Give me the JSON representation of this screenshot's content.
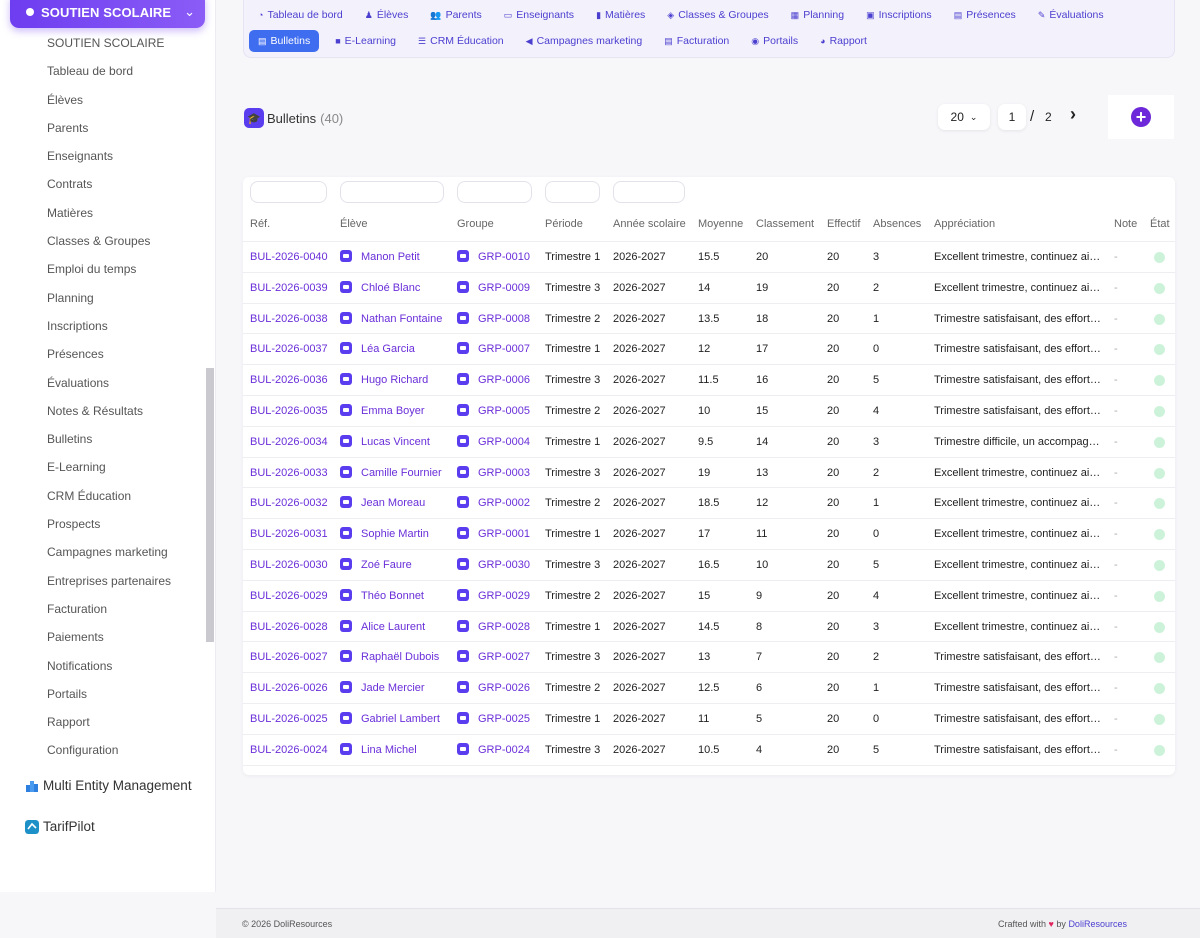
{
  "sidebar": {
    "module_title": "SOUTIEN SCOLAIRE",
    "items": [
      "SOUTIEN SCOLAIRE",
      "Tableau de bord",
      "Élèves",
      "Parents",
      "Enseignants",
      "Contrats",
      "Matières",
      "Classes & Groupes",
      "Emploi du temps",
      "Planning",
      "Inscriptions",
      "Présences",
      "Évaluations",
      "Notes & Résultats",
      "Bulletins",
      "E-Learning",
      "CRM Éducation",
      "Prospects",
      "Campagnes marketing",
      "Entreprises partenaires",
      "Facturation",
      "Paiements",
      "Notifications",
      "Portails",
      "Rapport",
      "Configuration"
    ],
    "ext_modules": [
      "Multi Entity Management",
      "TarifPilot"
    ]
  },
  "topnav": {
    "row1": [
      {
        "label": "Tableau de bord",
        "icon": "dashboard-icon"
      },
      {
        "label": "Élèves",
        "icon": "student-icon"
      },
      {
        "label": "Parents",
        "icon": "users-icon"
      },
      {
        "label": "Enseignants",
        "icon": "teacher-icon"
      },
      {
        "label": "Matières",
        "icon": "book-icon"
      },
      {
        "label": "Classes & Groupes",
        "icon": "layers-icon"
      },
      {
        "label": "Planning",
        "icon": "calendar-icon"
      },
      {
        "label": "Inscriptions",
        "icon": "clipboard-check-icon"
      },
      {
        "label": "Présences",
        "icon": "list-icon"
      },
      {
        "label": "Évaluations",
        "icon": "pen-icon"
      }
    ],
    "row2": [
      {
        "label": "Bulletins",
        "icon": "document-icon",
        "active": true
      },
      {
        "label": "E-Learning",
        "icon": "video-icon"
      },
      {
        "label": "CRM Éducation",
        "icon": "list-lines-icon"
      },
      {
        "label": "Campagnes marketing",
        "icon": "megaphone-icon"
      },
      {
        "label": "Facturation",
        "icon": "invoice-icon"
      },
      {
        "label": "Portails",
        "icon": "user-circle-icon"
      },
      {
        "label": "Rapport",
        "icon": "chart-pie-icon"
      }
    ]
  },
  "list": {
    "title": "Bulletins",
    "count": "(40)",
    "per_page": "20",
    "page_current": "1",
    "page_sep": "/",
    "page_total": "2",
    "next_symbol": "›",
    "add_symbol": "+"
  },
  "columns": [
    "Réf.",
    "Élève",
    "Groupe",
    "Période",
    "Année scolaire",
    "Moyenne",
    "Classement",
    "Effectif",
    "Absences",
    "Appréciation",
    "Note",
    "État"
  ],
  "rows": [
    {
      "ref": "BUL-2026-0040",
      "eleve": "Manon Petit",
      "groupe": "GRP-0010",
      "periode": "Trimestre 1",
      "annee": "2026-2027",
      "moyenne": "15.5",
      "classement": "20",
      "effectif": "20",
      "absences": "3",
      "appreciation": "Excellent trimestre, continuez ainsi.",
      "note": "-"
    },
    {
      "ref": "BUL-2026-0039",
      "eleve": "Chloé Blanc",
      "groupe": "GRP-0009",
      "periode": "Trimestre 3",
      "annee": "2026-2027",
      "moyenne": "14",
      "classement": "19",
      "effectif": "20",
      "absences": "2",
      "appreciation": "Excellent trimestre, continuez ainsi.",
      "note": "-"
    },
    {
      "ref": "BUL-2026-0038",
      "eleve": "Nathan Fontaine",
      "groupe": "GRP-0008",
      "periode": "Trimestre 2",
      "annee": "2026-2027",
      "moyenne": "13.5",
      "classement": "18",
      "effectif": "20",
      "absences": "1",
      "appreciation": "Trimestre satisfaisant, des efforts à poursuivre.",
      "note": "-"
    },
    {
      "ref": "BUL-2026-0037",
      "eleve": "Léa Garcia",
      "groupe": "GRP-0007",
      "periode": "Trimestre 1",
      "annee": "2026-2027",
      "moyenne": "12",
      "classement": "17",
      "effectif": "20",
      "absences": "0",
      "appreciation": "Trimestre satisfaisant, des efforts à poursuivre.",
      "note": "-"
    },
    {
      "ref": "BUL-2026-0036",
      "eleve": "Hugo Richard",
      "groupe": "GRP-0006",
      "periode": "Trimestre 3",
      "annee": "2026-2027",
      "moyenne": "11.5",
      "classement": "16",
      "effectif": "20",
      "absences": "5",
      "appreciation": "Trimestre satisfaisant, des efforts à poursuivre.",
      "note": "-"
    },
    {
      "ref": "BUL-2026-0035",
      "eleve": "Emma Boyer",
      "groupe": "GRP-0005",
      "periode": "Trimestre 2",
      "annee": "2026-2027",
      "moyenne": "10",
      "classement": "15",
      "effectif": "20",
      "absences": "4",
      "appreciation": "Trimestre satisfaisant, des efforts à poursuivre.",
      "note": "-"
    },
    {
      "ref": "BUL-2026-0034",
      "eleve": "Lucas Vincent",
      "groupe": "GRP-0004",
      "periode": "Trimestre 1",
      "annee": "2026-2027",
      "moyenne": "9.5",
      "classement": "14",
      "effectif": "20",
      "absences": "3",
      "appreciation": "Trimestre difficile, un accompagnement est conseillé.",
      "note": "-"
    },
    {
      "ref": "BUL-2026-0033",
      "eleve": "Camille Fournier",
      "groupe": "GRP-0003",
      "periode": "Trimestre 3",
      "annee": "2026-2027",
      "moyenne": "19",
      "classement": "13",
      "effectif": "20",
      "absences": "2",
      "appreciation": "Excellent trimestre, continuez ainsi.",
      "note": "-"
    },
    {
      "ref": "BUL-2026-0032",
      "eleve": "Jean Moreau",
      "groupe": "GRP-0002",
      "periode": "Trimestre 2",
      "annee": "2026-2027",
      "moyenne": "18.5",
      "classement": "12",
      "effectif": "20",
      "absences": "1",
      "appreciation": "Excellent trimestre, continuez ainsi.",
      "note": "-"
    },
    {
      "ref": "BUL-2026-0031",
      "eleve": "Sophie Martin",
      "groupe": "GRP-0001",
      "periode": "Trimestre 1",
      "annee": "2026-2027",
      "moyenne": "17",
      "classement": "11",
      "effectif": "20",
      "absences": "0",
      "appreciation": "Excellent trimestre, continuez ainsi.",
      "note": "-"
    },
    {
      "ref": "BUL-2026-0030",
      "eleve": "Zoé Faure",
      "groupe": "GRP-0030",
      "periode": "Trimestre 3",
      "annee": "2026-2027",
      "moyenne": "16.5",
      "classement": "10",
      "effectif": "20",
      "absences": "5",
      "appreciation": "Excellent trimestre, continuez ainsi.",
      "note": "-"
    },
    {
      "ref": "BUL-2026-0029",
      "eleve": "Théo Bonnet",
      "groupe": "GRP-0029",
      "periode": "Trimestre 2",
      "annee": "2026-2027",
      "moyenne": "15",
      "classement": "9",
      "effectif": "20",
      "absences": "4",
      "appreciation": "Excellent trimestre, continuez ainsi.",
      "note": "-"
    },
    {
      "ref": "BUL-2026-0028",
      "eleve": "Alice Laurent",
      "groupe": "GRP-0028",
      "periode": "Trimestre 1",
      "annee": "2026-2027",
      "moyenne": "14.5",
      "classement": "8",
      "effectif": "20",
      "absences": "3",
      "appreciation": "Excellent trimestre, continuez ainsi.",
      "note": "-"
    },
    {
      "ref": "BUL-2026-0027",
      "eleve": "Raphaël Dubois",
      "groupe": "GRP-0027",
      "periode": "Trimestre 3",
      "annee": "2026-2027",
      "moyenne": "13",
      "classement": "7",
      "effectif": "20",
      "absences": "2",
      "appreciation": "Trimestre satisfaisant, des efforts à poursuivre.",
      "note": "-"
    },
    {
      "ref": "BUL-2026-0026",
      "eleve": "Jade Mercier",
      "groupe": "GRP-0026",
      "periode": "Trimestre 2",
      "annee": "2026-2027",
      "moyenne": "12.5",
      "classement": "6",
      "effectif": "20",
      "absences": "1",
      "appreciation": "Trimestre satisfaisant, des efforts à poursuivre.",
      "note": "-"
    },
    {
      "ref": "BUL-2026-0025",
      "eleve": "Gabriel Lambert",
      "groupe": "GRP-0025",
      "periode": "Trimestre 1",
      "annee": "2026-2027",
      "moyenne": "11",
      "classement": "5",
      "effectif": "20",
      "absences": "0",
      "appreciation": "Trimestre satisfaisant, des efforts à poursuivre.",
      "note": "-"
    },
    {
      "ref": "BUL-2026-0024",
      "eleve": "Lina Michel",
      "groupe": "GRP-0024",
      "periode": "Trimestre 3",
      "annee": "2026-2027",
      "moyenne": "10.5",
      "classement": "4",
      "effectif": "20",
      "absences": "5",
      "appreciation": "Trimestre satisfaisant, des efforts à poursuivre.",
      "note": "-"
    }
  ],
  "footer": {
    "copyright": "© 2026 DoliResources",
    "crafted": "Crafted with",
    "heart": "♥",
    "by": "by",
    "brand": "DoliResources"
  },
  "colors": {
    "accent": "#6d3df0",
    "link": "#6a2fd9",
    "active_tab": "#3f6df0",
    "status_ok": "#cdf2da"
  }
}
